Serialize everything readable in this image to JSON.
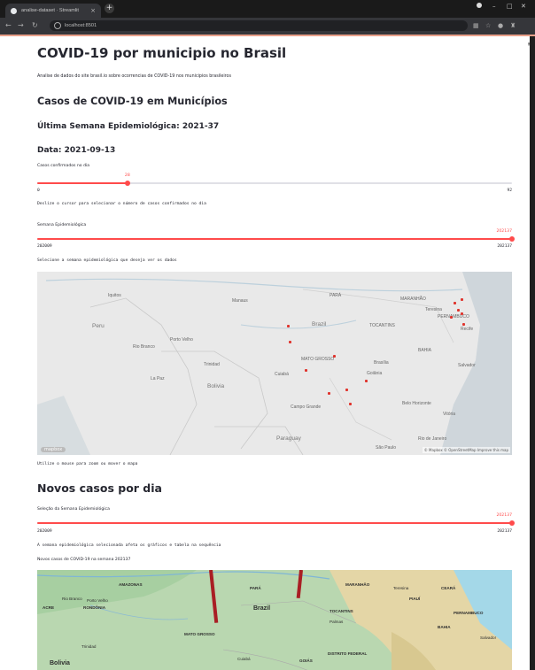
{
  "browser": {
    "tab_title": "analise-dataset · Streamlit",
    "tab_close": "×",
    "new_tab": "+",
    "url": "localhost:8501"
  },
  "page": {
    "title": "COVID-19 por municipio no Brasil",
    "subtitle": "Analise de dados do site brasil.io sobre ocorrencias de COVID-19 nos municipios brasileiros",
    "section1_title": "Casos de COVID-19 em Municípios",
    "week_heading": "Última Semana Epidemiológica: 2021-37",
    "date_heading": "Data: 2021-09-13"
  },
  "slider_cases": {
    "label": "Casos confirmados no dia",
    "value": "28",
    "fraction": 0.19,
    "min": "0",
    "max": "92",
    "help": "Deslize o cursor para selecionar o número de casos confirmados no dia"
  },
  "slider_week1": {
    "label": "Semana Epidemiológica",
    "value": "202137",
    "fraction": 1.0,
    "min": "202009",
    "max": "202137",
    "help": "Selecione a semana epidemiológica que deseja ver os dados"
  },
  "map1": {
    "labels": {
      "peru": "Peru",
      "brazil": "Brazil",
      "bolivia": "Bolivia",
      "paraguay": "Paraguay",
      "lapaz": "La Paz",
      "trinidad": "Trinidad",
      "mato_grosso": "MATO GROSSO",
      "goiania": "Goiânia",
      "brasilia": "Brasília",
      "belo_horizonte": "Belo Horizonte",
      "sao_paulo": "São Paulo",
      "salvador": "Salvador",
      "recife": "Recife",
      "manaus": "Manaus",
      "porto_velho": "Porto Velho",
      "rio_branco": "Rio Branco",
      "iquitos": "Iquitos",
      "cuiaba": "Cuiabá",
      "campo_grande": "Campo Grande",
      "maranhao": "MARANHÃO",
      "tocantins": "TOCANTINS",
      "bahia": "BAHIA",
      "pernambuco": "PERNAMBUCO",
      "para": "PARÁ",
      "rio": "Rio de Janeiro",
      "vitoria": "Vitória",
      "teresina": "Teresina"
    },
    "attribution": "© Mapbox © OpenStreetMap Improve this map",
    "logo": "mapbox"
  },
  "map1_help": "Utilize o mouse para zoom ou mover o mapa",
  "section2": {
    "title": "Novos casos por dia",
    "slider_label": "Seleção da Semana Epidemiológica",
    "slider_value": "202137",
    "slider_fraction": 1.0,
    "slider_min": "202009",
    "slider_max": "202137",
    "help": "A semana epidemiológica selecionada afeta os gráficos e tabela na sequência",
    "chart_caption": "Novos casos de COVID-19 na semana 202137"
  },
  "map2": {
    "labels": {
      "amazonas": "AMAZONAS",
      "acre": "ACRE",
      "rondonia": "RONDÔNIA",
      "porto_velho": "Porto Velho",
      "rio_branco": "Rio Branco",
      "para": "PARÁ",
      "maranhao": "MARANHÃO",
      "piaui": "PIAUÍ",
      "ceara": "CEARÁ",
      "pernambuco": "PERNAMBUCO",
      "tocantins": "TOCANTINS",
      "bahia": "BAHIA",
      "brazil": "Brazil",
      "mato_grosso": "MATO GROSSO",
      "bolivia": "Bolivia",
      "cuiaba": "Cuiabá",
      "trinidad": "Trinidad",
      "distrito": "DISTRITO FEDERAL",
      "goias": "GOIÁS",
      "salvador": "Salvador",
      "palmas": "Palmas",
      "teresina": "Teresina"
    }
  },
  "colors": {
    "accent": "#ff4b4b",
    "bar": "#a91e24"
  }
}
